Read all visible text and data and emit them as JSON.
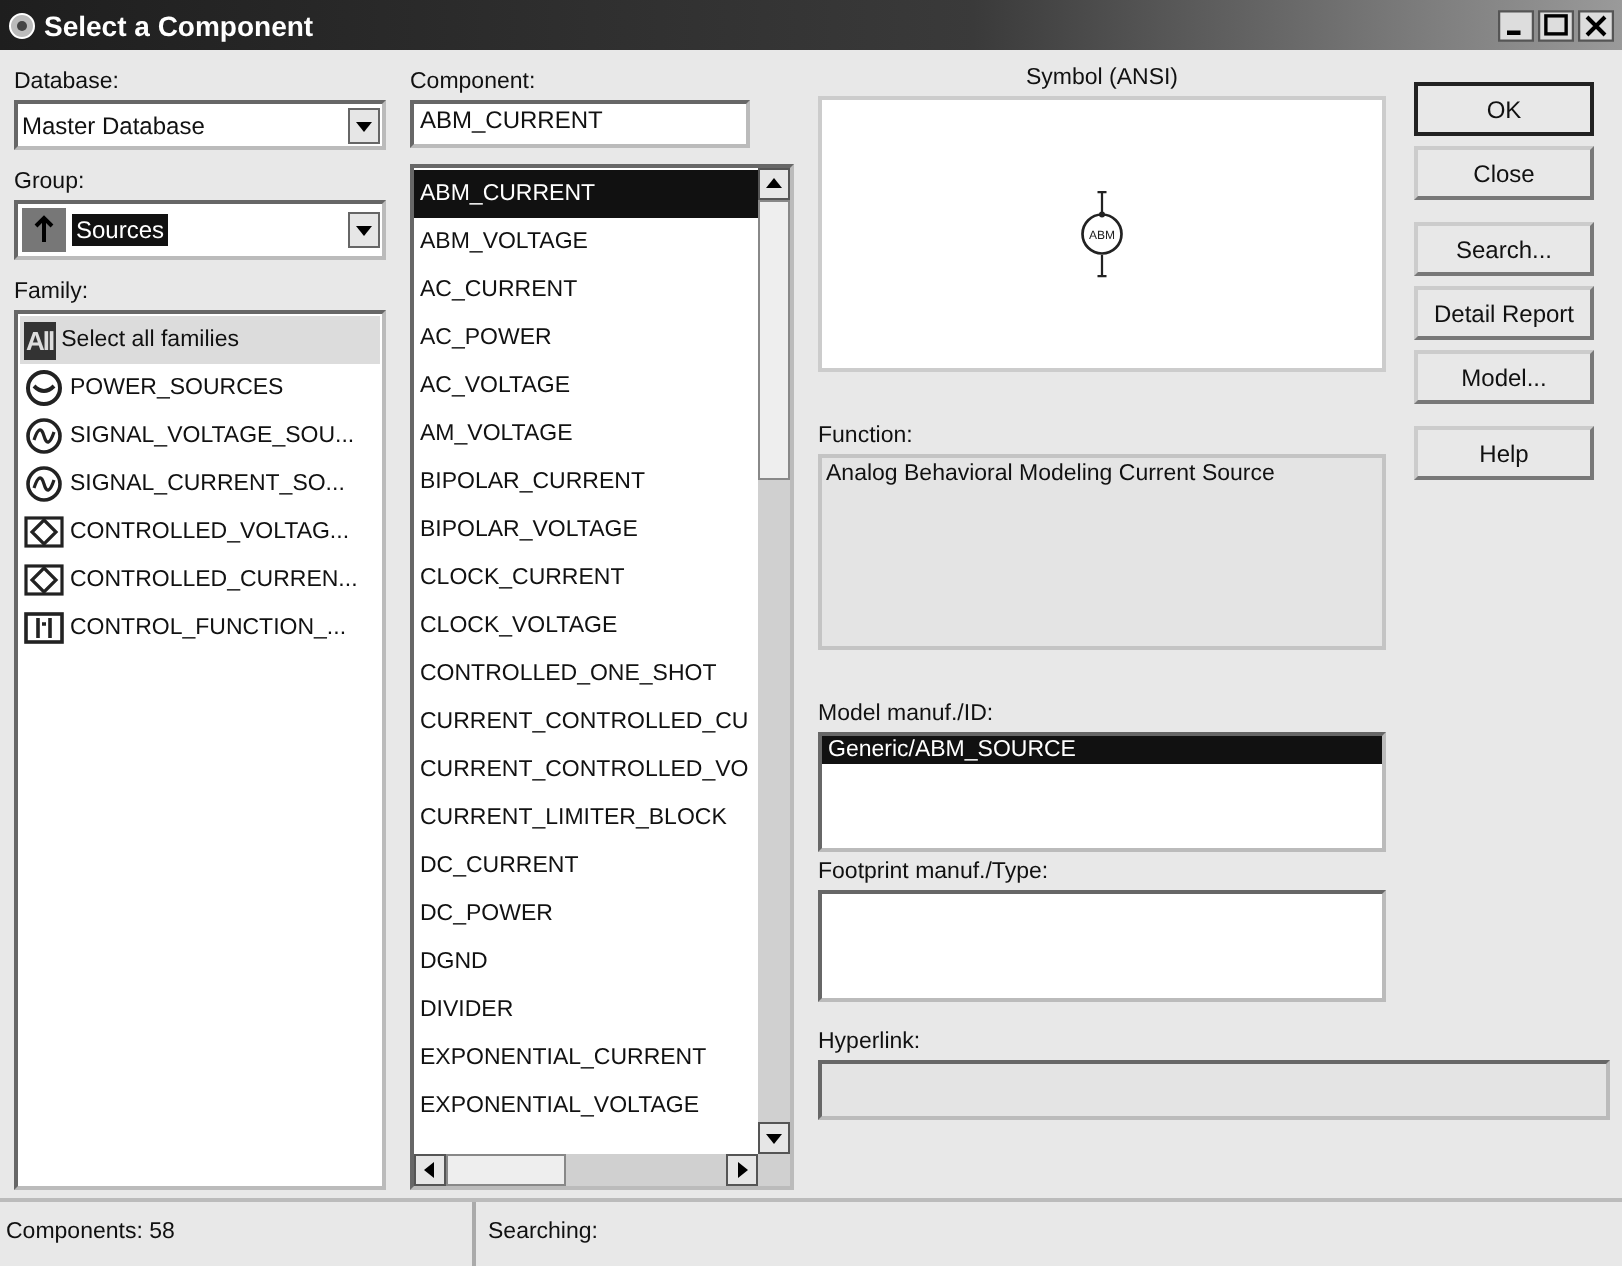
{
  "window": {
    "title": "Select a Component"
  },
  "database": {
    "label": "Database:",
    "value": "Master Database"
  },
  "group": {
    "label": "Group:",
    "value": "Sources"
  },
  "family": {
    "label": "Family:",
    "items": [
      {
        "kind": "all",
        "icon_text": "All",
        "label": "Select all families",
        "selected": true
      },
      {
        "kind": "power",
        "label": "POWER_SOURCES",
        "selected": false
      },
      {
        "kind": "signal",
        "label": "SIGNAL_VOLTAGE_SOU...",
        "selected": false
      },
      {
        "kind": "signal",
        "label": "SIGNAL_CURRENT_SO...",
        "selected": false
      },
      {
        "kind": "controlled",
        "label": "CONTROLLED_VOLTAG...",
        "selected": false
      },
      {
        "kind": "controlled",
        "label": "CONTROLLED_CURREN...",
        "selected": false
      },
      {
        "kind": "function",
        "label": "CONTROL_FUNCTION_...",
        "selected": false
      }
    ]
  },
  "component": {
    "label": "Component:",
    "value": "ABM_CURRENT",
    "items": [
      {
        "label": "ABM_CURRENT",
        "selected": true
      },
      {
        "label": "ABM_VOLTAGE",
        "selected": false
      },
      {
        "label": "AC_CURRENT",
        "selected": false
      },
      {
        "label": "AC_POWER",
        "selected": false
      },
      {
        "label": "AC_VOLTAGE",
        "selected": false
      },
      {
        "label": "AM_VOLTAGE",
        "selected": false
      },
      {
        "label": "BIPOLAR_CURRENT",
        "selected": false
      },
      {
        "label": "BIPOLAR_VOLTAGE",
        "selected": false
      },
      {
        "label": "CLOCK_CURRENT",
        "selected": false
      },
      {
        "label": "CLOCK_VOLTAGE",
        "selected": false
      },
      {
        "label": "CONTROLLED_ONE_SHOT",
        "selected": false
      },
      {
        "label": "CURRENT_CONTROLLED_CU",
        "selected": false
      },
      {
        "label": "CURRENT_CONTROLLED_VO",
        "selected": false
      },
      {
        "label": "CURRENT_LIMITER_BLOCK",
        "selected": false
      },
      {
        "label": "DC_CURRENT",
        "selected": false
      },
      {
        "label": "DC_POWER",
        "selected": false
      },
      {
        "label": "DGND",
        "selected": false
      },
      {
        "label": "DIVIDER",
        "selected": false
      },
      {
        "label": "EXPONENTIAL_CURRENT",
        "selected": false
      },
      {
        "label": "EXPONENTIAL_VOLTAGE",
        "selected": false
      }
    ]
  },
  "symbol": {
    "label": "Symbol (ANSI)",
    "text": "ABM"
  },
  "function": {
    "label": "Function:",
    "value": "Analog Behavioral Modeling Current Source"
  },
  "model": {
    "label": "Model manuf./ID:",
    "items": [
      {
        "label": "Generic/ABM_SOURCE",
        "selected": true
      }
    ]
  },
  "footprint": {
    "label": "Footprint manuf./Type:"
  },
  "hyperlink": {
    "label": "Hyperlink:"
  },
  "buttons": [
    {
      "label": "OK",
      "default": true
    },
    {
      "label": "Close",
      "default": false
    },
    {
      "label": "Search...",
      "default": false
    },
    {
      "label": "Detail Report",
      "default": false
    },
    {
      "label": "Model...",
      "default": false
    },
    {
      "label": "Help",
      "default": false
    }
  ],
  "status_bar": [
    "Components: 58",
    "Searching:"
  ]
}
